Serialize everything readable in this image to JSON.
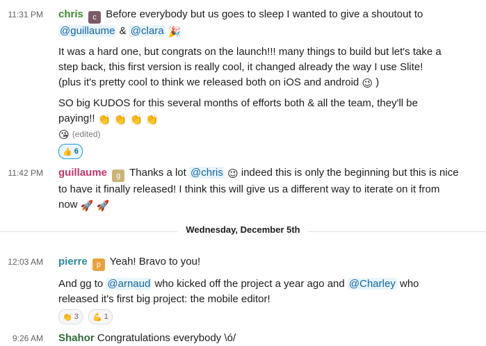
{
  "messages": [
    {
      "time": "11:31 PM",
      "author": "chris",
      "line1": "Before everybody but us goes to sleep I wanted to give a shoutout to",
      "mention1": "@guillaume",
      "amp": "&",
      "mention2": "@clara",
      "p2_l1": "It was a hard one, but congrats on the launch!!! many things to build but let's take a",
      "p2_l2": "step back, this first version is really cool, it changed already the way I use Slite!",
      "p2_l3": "(plus it's pretty cool to think we released both on iOS and android",
      "p2_l3_end": ")",
      "p3_l1": "SO big KUDOS for this several months of efforts both & all the team, they'll be",
      "p3_l2": "paying!!",
      "edited": "(edited)",
      "reaction_count": "6"
    },
    {
      "time": "11:42 PM",
      "author": "guillaume",
      "l1_a": "Thanks a lot",
      "mention": "@chris",
      "l1_b": "indeed this is only the beginning but this is nice",
      "l2": "to have it finally released! I think this will give us a different way to iterate on it from",
      "l3": "now"
    },
    {
      "time": "12:03 AM",
      "author": "pierre",
      "l1": "Yeah! Bravo to you!",
      "p2_a": "And gg to",
      "mention1": "@arnaud",
      "p2_b": "who kicked off the project a year ago and",
      "mention2": "@Charley",
      "p2_c": "who",
      "p2_l2": "released it's first big project: the mobile editor!",
      "reaction1_count": "3",
      "reaction2_count": "1"
    },
    {
      "time": "9:26 AM",
      "author": "Shahor",
      "text": "Congratulations everybody \\ó/"
    }
  ],
  "day_divider": "Wednesday, December 5th",
  "icons": {
    "party": "🎉",
    "wink": "😉",
    "clap": "👏",
    "kiss": "😘",
    "thumbs_up": "👍",
    "rocket": "🚀",
    "hotdog": "🌭",
    "muscle": "💪"
  }
}
